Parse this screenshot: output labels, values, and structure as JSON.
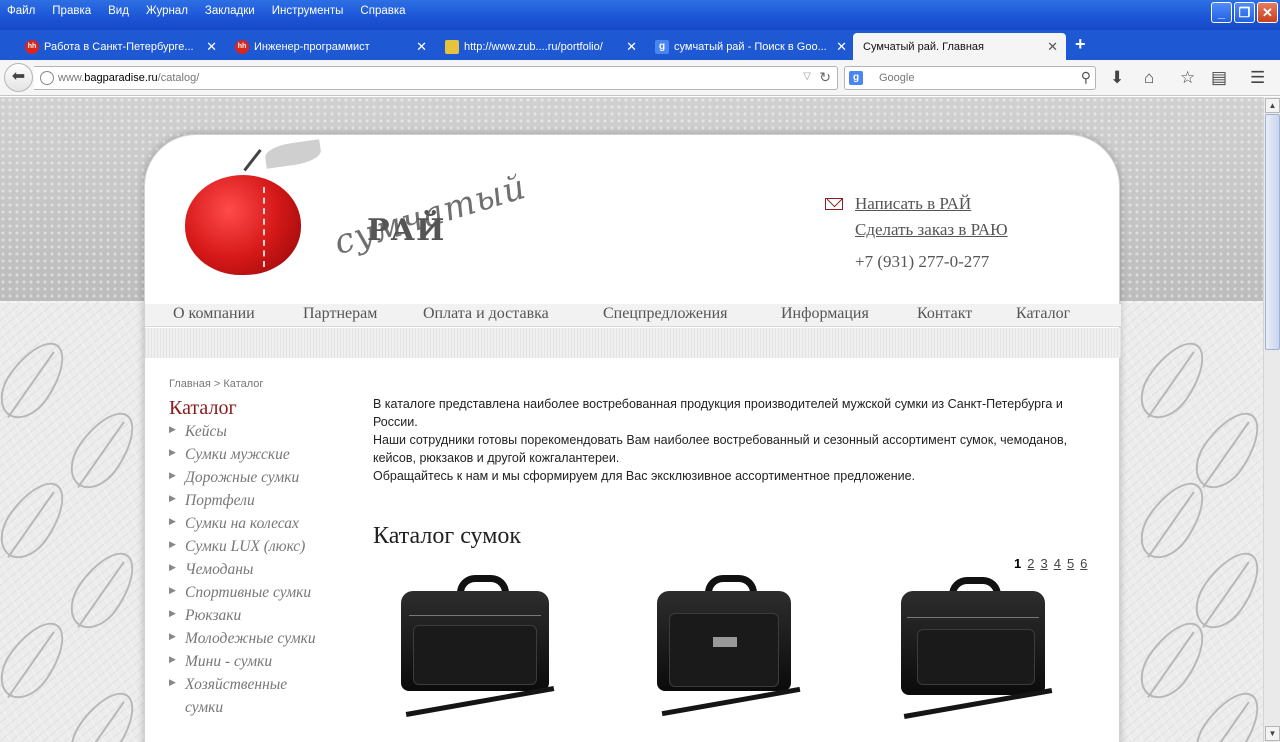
{
  "menu": [
    "Файл",
    "Правка",
    "Вид",
    "Журнал",
    "Закладки",
    "Инструменты",
    "Справка"
  ],
  "tabs": [
    {
      "label": "Работа в Санкт-Петербурге...",
      "icon": "hh-icon",
      "fav": "hh"
    },
    {
      "label": "Инженер-программист",
      "icon": "hh-icon",
      "fav": "hh"
    },
    {
      "label": "http://www.zub....ru/portfolio/",
      "icon": "site-icon",
      "fav": ""
    },
    {
      "label": "сумчатый рай - Поиск в Goo...",
      "icon": "google-icon",
      "fav": "g"
    },
    {
      "label": "Сумчатый рай. Главная",
      "icon": "",
      "fav": ""
    }
  ],
  "address": {
    "host": "www.",
    "domain": "bagparadise.ru",
    "path": "/catalog/"
  },
  "search": {
    "placeholder": "Google",
    "engine": "g"
  },
  "site": {
    "logo_script": "сумчатый",
    "logo_name": "РАЙ",
    "write_link": "Написать в РАЙ",
    "order_link": "Сделать заказ в РАЮ",
    "phone": "+7 (931) 277-0-277"
  },
  "nav": [
    "О компании",
    "Партнерам",
    "Оплата и доставка",
    "Спецпредложения",
    "Информация",
    "Контакт",
    "Каталог"
  ],
  "breadcrumb": "Главная > Каталог",
  "sidebar": {
    "title": "Каталог",
    "items": [
      "Кейсы",
      "Сумки мужские",
      "Дорожные сумки",
      "Портфели",
      "Сумки на колесах",
      "Сумки LUX (люкс)",
      "Чемоданы",
      "Спортивные сумки",
      "Рюкзаки",
      "Молодежные сумки",
      "Мини - сумки",
      "Хозяйственные сумки"
    ]
  },
  "intro": {
    "l1": "В каталоге представлена наиболее востребованная продукция производителей мужской сумки из Санкт-Петербурга и России.",
    "l2": "Наши сотрудники готовы порекомендовать Вам наиболее востребованный и сезонный ассортимент сумок, чемоданов, кейсов, рюкзаков и другой кожгалантереи.",
    "l3": "Обращайтесь к нам и мы сформируем для Вас эксклюзивное ассортиментное предложение."
  },
  "section_title": "Каталог сумок",
  "pager": {
    "current": "1",
    "pages": [
      "2",
      "3",
      "4",
      "5",
      "6"
    ]
  },
  "colors": {
    "accent": "#8b1a1a",
    "chrome": "#1f58d3"
  }
}
